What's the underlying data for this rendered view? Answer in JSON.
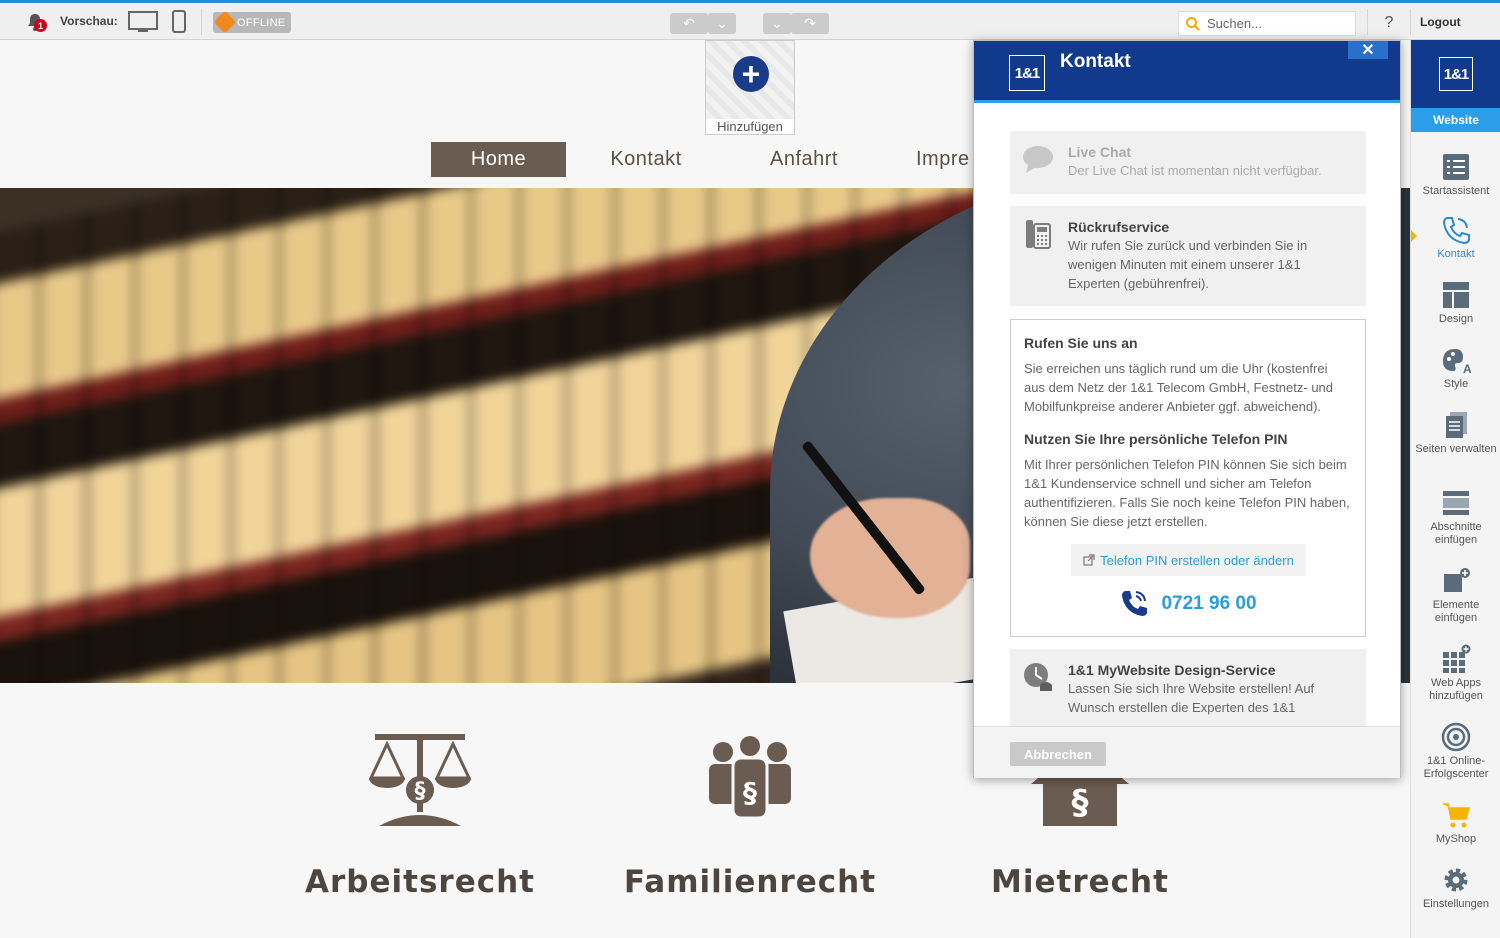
{
  "toolbar": {
    "notification_count": "1",
    "preview_label": "Vorschau:",
    "offline_label": "OFFLINE",
    "search_placeholder": "Suchen...",
    "help_label": "?",
    "logout_label": "Logout",
    "undo_icon": "undo-icon",
    "redo_icon": "redo-icon"
  },
  "site": {
    "add_label": "Hinzufügen",
    "nav": [
      "Home",
      "Kontakt",
      "Anfahrt",
      "Impre"
    ],
    "features": [
      {
        "label": "Arbeitsrecht",
        "icon": "scales-icon"
      },
      {
        "label": "Familienrecht",
        "icon": "family-law-icon"
      },
      {
        "label": "Mietrecht",
        "icon": "house-law-icon"
      }
    ]
  },
  "panel": {
    "logo": "1&1",
    "title": "Kontakt",
    "close": "✕",
    "live_chat": {
      "title": "Live Chat",
      "text": "Der Live Chat ist momentan nicht verfügbar."
    },
    "callback": {
      "title": "Rückrufservice",
      "text": "Wir rufen Sie zurück und verbinden Sie in wenigen Minuten mit einem unserer 1&1 Experten (gebührenfrei)."
    },
    "call": {
      "title": "Rufen Sie uns an",
      "text": "Sie erreichen uns täglich rund um die Uhr (kostenfrei aus dem Netz der 1&1 Telecom GmbH, Festnetz- und Mobilfunkpreise anderer Anbieter ggf. abweichend).",
      "pin_title": "Nutzen Sie Ihre persönliche Telefon PIN",
      "pin_text": "Mit Ihrer persönlichen Telefon PIN können Sie sich beim 1&1 Kundenservice schnell und sicher am Telefon authentifizieren. Falls Sie noch keine Telefon PIN haben, können Sie diese jetzt erstellen.",
      "pin_button": "Telefon PIN erstellen oder ändern",
      "phone_number": "0721 96 00"
    },
    "design_service": {
      "title": "1&1 MyWebsite Design-Service",
      "text": "Lassen Sie sich Ihre Website erstellen! Auf Wunsch erstellen die Experten des 1&1"
    },
    "cancel": "Abbrechen"
  },
  "sidebar": {
    "logo": "1&1",
    "tab": "Website",
    "items": [
      {
        "label": "Startassistent",
        "icon": "checklist-icon"
      },
      {
        "label": "Kontakt",
        "icon": "phone-icon"
      },
      {
        "label": "Design",
        "icon": "layout-icon"
      },
      {
        "label": "Style",
        "icon": "palette-icon"
      },
      {
        "label": "Seiten verwalten",
        "icon": "pages-icon"
      },
      {
        "label": "Abschnitte einfügen",
        "icon": "section-icon"
      },
      {
        "label": "Elemente einfügen",
        "icon": "element-add-icon"
      },
      {
        "label": "Web Apps hinzufügen",
        "icon": "apps-icon"
      },
      {
        "label": "1&1 Online-Erfolgscenter",
        "icon": "target-icon"
      },
      {
        "label": "MyShop",
        "icon": "cart-icon"
      },
      {
        "label": "Einstellungen",
        "icon": "gear-icon"
      }
    ]
  }
}
